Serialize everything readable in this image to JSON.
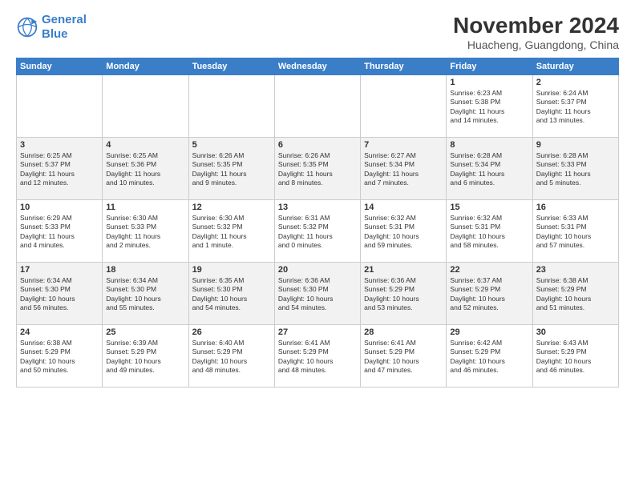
{
  "logo": {
    "line1": "General",
    "line2": "Blue"
  },
  "title": "November 2024",
  "subtitle": "Huacheng, Guangdong, China",
  "weekdays": [
    "Sunday",
    "Monday",
    "Tuesday",
    "Wednesday",
    "Thursday",
    "Friday",
    "Saturday"
  ],
  "weeks": [
    [
      {
        "day": "",
        "info": ""
      },
      {
        "day": "",
        "info": ""
      },
      {
        "day": "",
        "info": ""
      },
      {
        "day": "",
        "info": ""
      },
      {
        "day": "",
        "info": ""
      },
      {
        "day": "1",
        "info": "Sunrise: 6:23 AM\nSunset: 5:38 PM\nDaylight: 11 hours\nand 14 minutes."
      },
      {
        "day": "2",
        "info": "Sunrise: 6:24 AM\nSunset: 5:37 PM\nDaylight: 11 hours\nand 13 minutes."
      }
    ],
    [
      {
        "day": "3",
        "info": "Sunrise: 6:25 AM\nSunset: 5:37 PM\nDaylight: 11 hours\nand 12 minutes."
      },
      {
        "day": "4",
        "info": "Sunrise: 6:25 AM\nSunset: 5:36 PM\nDaylight: 11 hours\nand 10 minutes."
      },
      {
        "day": "5",
        "info": "Sunrise: 6:26 AM\nSunset: 5:35 PM\nDaylight: 11 hours\nand 9 minutes."
      },
      {
        "day": "6",
        "info": "Sunrise: 6:26 AM\nSunset: 5:35 PM\nDaylight: 11 hours\nand 8 minutes."
      },
      {
        "day": "7",
        "info": "Sunrise: 6:27 AM\nSunset: 5:34 PM\nDaylight: 11 hours\nand 7 minutes."
      },
      {
        "day": "8",
        "info": "Sunrise: 6:28 AM\nSunset: 5:34 PM\nDaylight: 11 hours\nand 6 minutes."
      },
      {
        "day": "9",
        "info": "Sunrise: 6:28 AM\nSunset: 5:33 PM\nDaylight: 11 hours\nand 5 minutes."
      }
    ],
    [
      {
        "day": "10",
        "info": "Sunrise: 6:29 AM\nSunset: 5:33 PM\nDaylight: 11 hours\nand 4 minutes."
      },
      {
        "day": "11",
        "info": "Sunrise: 6:30 AM\nSunset: 5:33 PM\nDaylight: 11 hours\nand 2 minutes."
      },
      {
        "day": "12",
        "info": "Sunrise: 6:30 AM\nSunset: 5:32 PM\nDaylight: 11 hours\nand 1 minute."
      },
      {
        "day": "13",
        "info": "Sunrise: 6:31 AM\nSunset: 5:32 PM\nDaylight: 11 hours\nand 0 minutes."
      },
      {
        "day": "14",
        "info": "Sunrise: 6:32 AM\nSunset: 5:31 PM\nDaylight: 10 hours\nand 59 minutes."
      },
      {
        "day": "15",
        "info": "Sunrise: 6:32 AM\nSunset: 5:31 PM\nDaylight: 10 hours\nand 58 minutes."
      },
      {
        "day": "16",
        "info": "Sunrise: 6:33 AM\nSunset: 5:31 PM\nDaylight: 10 hours\nand 57 minutes."
      }
    ],
    [
      {
        "day": "17",
        "info": "Sunrise: 6:34 AM\nSunset: 5:30 PM\nDaylight: 10 hours\nand 56 minutes."
      },
      {
        "day": "18",
        "info": "Sunrise: 6:34 AM\nSunset: 5:30 PM\nDaylight: 10 hours\nand 55 minutes."
      },
      {
        "day": "19",
        "info": "Sunrise: 6:35 AM\nSunset: 5:30 PM\nDaylight: 10 hours\nand 54 minutes."
      },
      {
        "day": "20",
        "info": "Sunrise: 6:36 AM\nSunset: 5:30 PM\nDaylight: 10 hours\nand 54 minutes."
      },
      {
        "day": "21",
        "info": "Sunrise: 6:36 AM\nSunset: 5:29 PM\nDaylight: 10 hours\nand 53 minutes."
      },
      {
        "day": "22",
        "info": "Sunrise: 6:37 AM\nSunset: 5:29 PM\nDaylight: 10 hours\nand 52 minutes."
      },
      {
        "day": "23",
        "info": "Sunrise: 6:38 AM\nSunset: 5:29 PM\nDaylight: 10 hours\nand 51 minutes."
      }
    ],
    [
      {
        "day": "24",
        "info": "Sunrise: 6:38 AM\nSunset: 5:29 PM\nDaylight: 10 hours\nand 50 minutes."
      },
      {
        "day": "25",
        "info": "Sunrise: 6:39 AM\nSunset: 5:29 PM\nDaylight: 10 hours\nand 49 minutes."
      },
      {
        "day": "26",
        "info": "Sunrise: 6:40 AM\nSunset: 5:29 PM\nDaylight: 10 hours\nand 48 minutes."
      },
      {
        "day": "27",
        "info": "Sunrise: 6:41 AM\nSunset: 5:29 PM\nDaylight: 10 hours\nand 48 minutes."
      },
      {
        "day": "28",
        "info": "Sunrise: 6:41 AM\nSunset: 5:29 PM\nDaylight: 10 hours\nand 47 minutes."
      },
      {
        "day": "29",
        "info": "Sunrise: 6:42 AM\nSunset: 5:29 PM\nDaylight: 10 hours\nand 46 minutes."
      },
      {
        "day": "30",
        "info": "Sunrise: 6:43 AM\nSunset: 5:29 PM\nDaylight: 10 hours\nand 46 minutes."
      }
    ]
  ]
}
